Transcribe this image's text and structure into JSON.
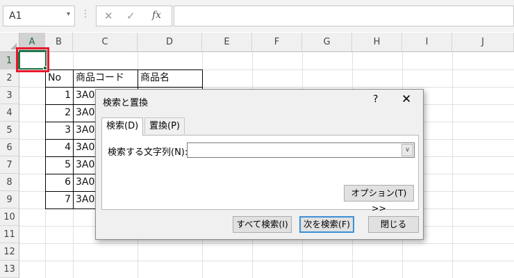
{
  "formula_bar": {
    "name_box": "A1",
    "name_box_arrow": "▾",
    "separator": "⋮",
    "cancel_icon": "✕",
    "enter_icon": "✓",
    "fx_icon": "fx",
    "formula_value": ""
  },
  "columns": [
    "A",
    "B",
    "C",
    "D",
    "E",
    "F",
    "G",
    "H",
    "I",
    "J"
  ],
  "rows": [
    "1",
    "2",
    "3",
    "4",
    "5",
    "6",
    "7",
    "8",
    "9",
    "10",
    "11",
    "12",
    "13"
  ],
  "sheet": {
    "header": {
      "b": "No",
      "c": "商品コード",
      "d": "商品名"
    },
    "data": [
      {
        "no": "1",
        "code": "3A00"
      },
      {
        "no": "2",
        "code": "3A00"
      },
      {
        "no": "3",
        "code": "3A00"
      },
      {
        "no": "4",
        "code": "3A00"
      },
      {
        "no": "5",
        "code": "3A00"
      },
      {
        "no": "6",
        "code": "3A00"
      },
      {
        "no": "7",
        "code": "3A00"
      }
    ]
  },
  "dialog": {
    "title": "検索と置換",
    "help": "?",
    "close_icon": "✕",
    "tab_find": "検索(D)",
    "tab_replace": "置換(P)",
    "find_label": "検索する文字列(N):",
    "find_value": "",
    "combo_arrow": "∨",
    "options_button": "オプション(T) >>",
    "find_all_button": "すべて検索(I)",
    "find_next_button": "次を検索(F)",
    "close_button": "閉じる"
  },
  "colors": {
    "selection": "#217346",
    "highlight_box": "#e8192c",
    "default_button_border": "#3c8fd6"
  }
}
